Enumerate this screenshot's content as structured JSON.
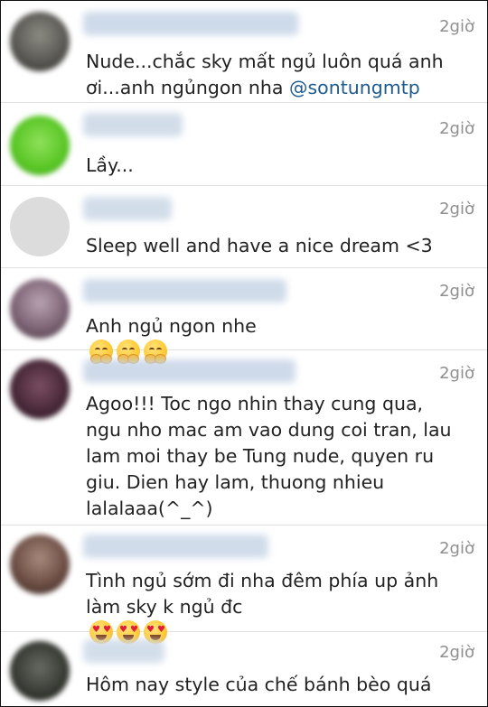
{
  "comments": [
    {
      "time": "2giờ",
      "text": "Nude...chắc sky mất ngủ luôn quá anh\nơi...anh ngủngon nha ",
      "mention": "@sontungmtp",
      "emoji": []
    },
    {
      "time": "2giờ",
      "text": "Lầy...",
      "mention": "",
      "emoji": []
    },
    {
      "time": "2giờ",
      "text": "Sleep well and have a nice dream <3",
      "mention": "",
      "emoji": []
    },
    {
      "time": "2giờ",
      "text": "Anh ngủ ngon nhe",
      "mention": "",
      "emoji": [
        "hugging-face-emoji",
        "hugging-face-emoji",
        "hugging-face-emoji"
      ]
    },
    {
      "time": "2giờ",
      "text": "Agoo!!! Toc ngo nhin thay cung qua,\nngu nho mac am vao dung coi tran, lau\nlam moi thay be Tung nude, quyen ru\ngiu. Dien hay lam, thuong nhieu\nlalalaaa(^_^)",
      "mention": "",
      "emoji": []
    },
    {
      "time": "2giờ",
      "text": "Tình ngủ sớm đi nha đêm phía up ảnh\nlàm sky k ngủ đc",
      "mention": "",
      "emoji": [
        "heart-eyes-emoji",
        "heart-eyes-emoji",
        "heart-eyes-emoji"
      ]
    },
    {
      "time": "2giờ",
      "text": "Hôm nay style của chế bánh bèo quá",
      "mention": "",
      "emoji": []
    }
  ],
  "colors": {
    "username_blur": "#c9d6e6",
    "timestamp": "#8f8f8f",
    "mention": "#1f5b8f",
    "divider": "#e1e1e1"
  }
}
